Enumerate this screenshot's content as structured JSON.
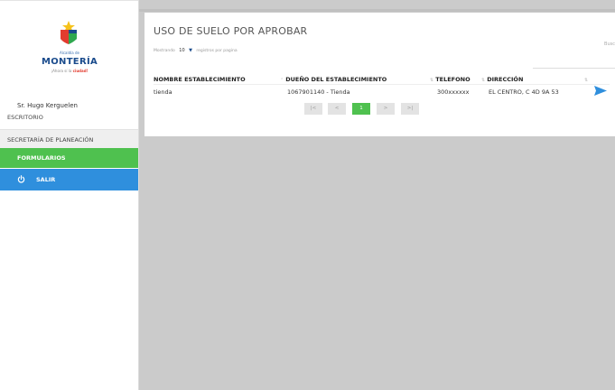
{
  "logo": {
    "alcaldia": "Alcaldía de",
    "name": "MONTERÍA",
    "tagline_prefix": "¡Ahora sí la",
    "tagline_highlight": "ciudad!"
  },
  "user": {
    "name": "Sr. Hugo Kerguelen"
  },
  "nav": {
    "escritorio": "ESCRITORIO",
    "secretaria": "SECRETARÍA DE PLANEACIÓN",
    "formularios": "FORMULARIOS",
    "salir": "SALIR"
  },
  "card": {
    "title": "USO DE SUELO POR APROBAR",
    "showing_prefix": "Mostrando",
    "page_size": "10",
    "showing_suffix": "registros por pagina",
    "search_label": "Busc"
  },
  "table": {
    "columns": [
      "NOMBRE ESTABLECIMIENTO",
      "DUEÑO DEL ESTABLECIMIENTO",
      "TELEFONO",
      "DIRECCIÓN"
    ],
    "rows": [
      {
        "nombre": "tienda",
        "dueno": "1067901140 - Tienda",
        "telefono": "300xxxxxx",
        "direccion": "EL CENTRO, C 4D 9A 53"
      }
    ]
  },
  "pagination": {
    "first": "|<",
    "prev": "<",
    "current": "1",
    "next": ">",
    "last": ">|"
  },
  "colors": {
    "green": "#4fc14f",
    "blue": "#2f8fdd",
    "gray_bg": "#cbcbcb"
  },
  "icons": {
    "power": "power-icon",
    "send": "send-icon",
    "sort": "sort-icon"
  }
}
